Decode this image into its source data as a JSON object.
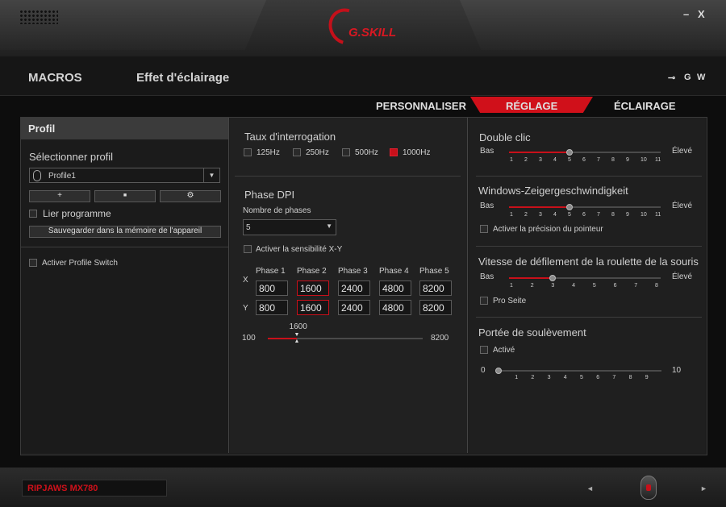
{
  "window": {
    "brand": "G.SKILL",
    "minimize": "–",
    "close": "X"
  },
  "nav": {
    "macros": "MACROS",
    "lighting_effect": "Effet d'éclairage",
    "icons": [
      "⊸",
      "G",
      "W"
    ]
  },
  "tabs": [
    {
      "label": "PERSONNALISER"
    },
    {
      "label": "RÉGLAGE",
      "active": true
    },
    {
      "label": "ÉCLAIRAGE"
    }
  ],
  "profile": {
    "header": "Profil",
    "select_label": "Sélectionner profil",
    "selected_profile": "Profile1",
    "buttons": [
      "+",
      "■",
      "⚙"
    ],
    "link_program": "Lier programme",
    "save_button": "Sauvegarder dans la mémoire de l'appareil",
    "profile_switch": "Activer Profile Switch"
  },
  "polling": {
    "title": "Taux d'interrogation",
    "options": [
      "125Hz",
      "250Hz",
      "500Hz",
      "1000Hz"
    ],
    "selected": "1000Hz"
  },
  "dpi": {
    "title": "Phase DPI",
    "phase_count_label": "Nombre de phases",
    "phase_count": "5",
    "xy_label": "Activer la sensibilité X-Y",
    "phase_headers": [
      "Phase 1",
      "Phase 2",
      "Phase 3",
      "Phase 4",
      "Phase 5"
    ],
    "axis_x": "X",
    "axis_y": "Y",
    "x_values": [
      "800",
      "1600",
      "2400",
      "4800",
      "8200"
    ],
    "y_values": [
      "800",
      "1600",
      "2400",
      "4800",
      "8200"
    ],
    "active_phase": 2,
    "slider_min": "100",
    "slider_max": "8200",
    "slider_value": "1600",
    "slider_fraction": 0.185
  },
  "double_click": {
    "title": "Double clic",
    "low": "Bas",
    "high": "Élevé",
    "ticks": [
      "1",
      "2",
      "3",
      "4",
      "5",
      "6",
      "7",
      "8",
      "9",
      "10",
      "11"
    ],
    "value": 5
  },
  "pointer_speed": {
    "title": "Windows-Zeigergeschwindigkeit",
    "low": "Bas",
    "high": "Élevé",
    "ticks": [
      "1",
      "2",
      "3",
      "4",
      "5",
      "6",
      "7",
      "8",
      "9",
      "10",
      "11"
    ],
    "value": 5,
    "precision_label": "Activer la précision du pointeur"
  },
  "scroll_speed": {
    "title": "Vitesse de défilement de la roulette de la souris",
    "low": "Bas",
    "high": "Élevé",
    "ticks": [
      "1",
      "2",
      "3",
      "4",
      "5",
      "6",
      "7",
      "8"
    ],
    "value": 3,
    "pro_seite": "Pro Seite"
  },
  "lift_off": {
    "title": "Portée de soulèvement",
    "enabled_label": "Activé",
    "min": "0",
    "max": "10",
    "ticks": [
      "1",
      "2",
      "3",
      "4",
      "5",
      "6",
      "7",
      "8",
      "9"
    ],
    "value": 0
  },
  "footer": {
    "device": "RIPJAWS MX780",
    "prev": "◄",
    "next": "►"
  },
  "colors": {
    "accent": "#d0101a"
  }
}
